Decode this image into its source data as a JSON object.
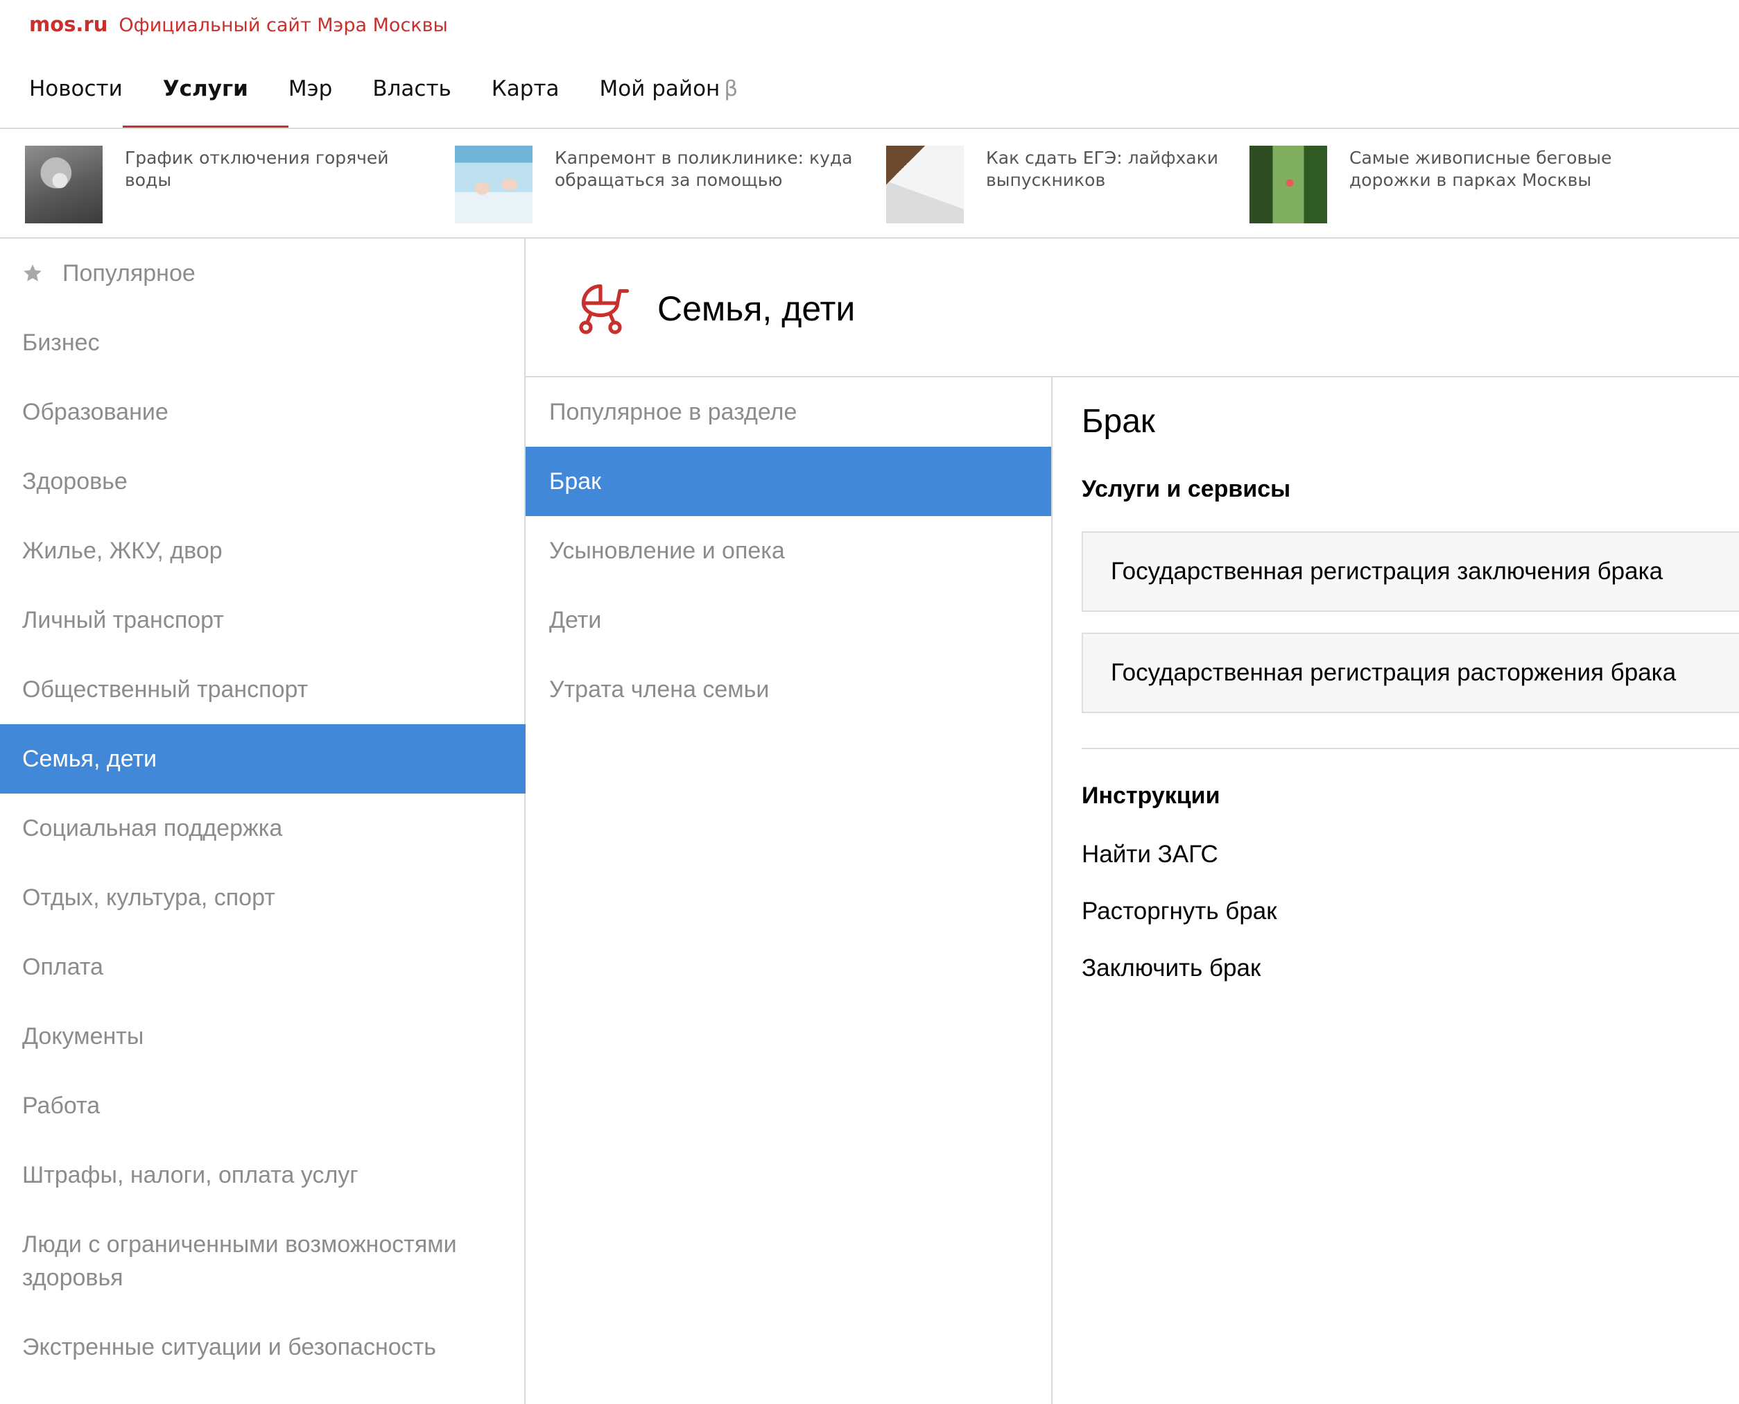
{
  "brand": {
    "logo": "mos.ru",
    "tagline": "Официальный сайт Мэра Москвы"
  },
  "nav": {
    "items": [
      {
        "label": "Новости"
      },
      {
        "label": "Услуги",
        "active": true
      },
      {
        "label": "Мэр"
      },
      {
        "label": "Власть"
      },
      {
        "label": "Карта"
      },
      {
        "label": "Мой район",
        "suffix": "β"
      }
    ]
  },
  "news": [
    {
      "text": "График отключения горячей воды"
    },
    {
      "text": "Капремонт в поликлинике: куда обращаться за помощью"
    },
    {
      "text": "Как сдать ЕГЭ: лайфхаки выпускников"
    },
    {
      "text": "Самые живописные беговые дорожки в парках Москвы"
    }
  ],
  "sidebar": {
    "items": [
      {
        "label": "Популярное",
        "icon": "star-icon"
      },
      {
        "label": "Бизнес"
      },
      {
        "label": "Образование"
      },
      {
        "label": "Здоровье"
      },
      {
        "label": "Жилье, ЖКУ, двор"
      },
      {
        "label": "Личный транспорт"
      },
      {
        "label": "Общественный транспорт"
      },
      {
        "label": "Семья, дети",
        "active": true
      },
      {
        "label": "Социальная поддержка"
      },
      {
        "label": "Отдых, культура, спорт"
      },
      {
        "label": "Оплата"
      },
      {
        "label": "Документы"
      },
      {
        "label": "Работа"
      },
      {
        "label": "Штрафы, налоги, оплата услуг"
      },
      {
        "label": "Люди с ограниченными возможностями здоровья"
      },
      {
        "label": "Экстренные ситуации и безопасность"
      }
    ]
  },
  "category": {
    "title": "Семья, дети",
    "icon": "stroller-icon",
    "icon_color": "#c8302e"
  },
  "submenu": {
    "items": [
      {
        "label": "Популярное в разделе"
      },
      {
        "label": "Брак",
        "active": true
      },
      {
        "label": "Усыновление и опека"
      },
      {
        "label": "Дети"
      },
      {
        "label": "Утрата члена семьи"
      }
    ]
  },
  "content": {
    "title": "Брак",
    "services_heading": "Услуги и сервисы",
    "services": [
      {
        "label": "Государственная регистрация заключения брака"
      },
      {
        "label": "Государственная регистрация расторжения брака"
      }
    ],
    "instructions_heading": "Инструкции",
    "instructions": [
      {
        "label": "Найти ЗАГС"
      },
      {
        "label": "Расторгнуть брак"
      },
      {
        "label": "Заключить брак"
      }
    ]
  },
  "colors": {
    "accent_red": "#c8302e",
    "active_blue": "#4189d8",
    "muted_text": "#8c8c8c"
  }
}
